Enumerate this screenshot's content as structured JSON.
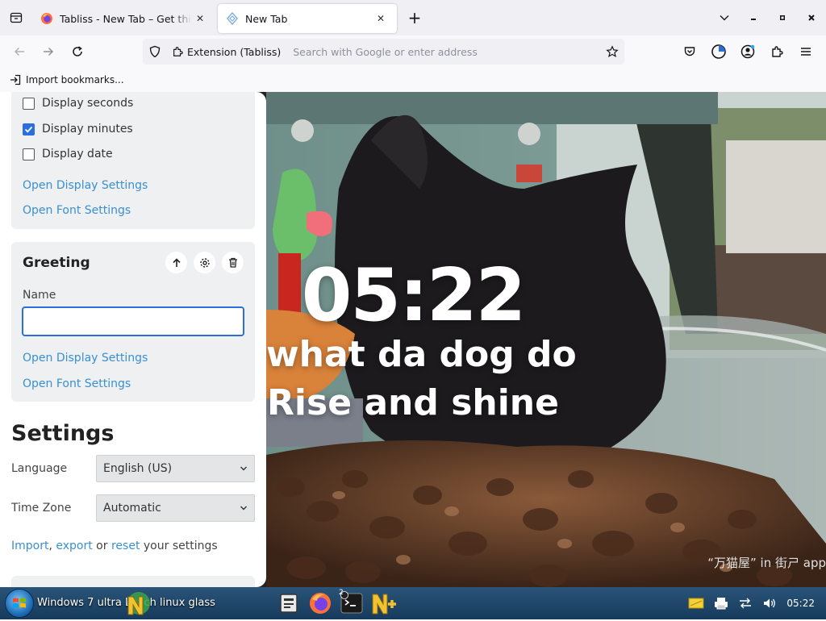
{
  "browser": {
    "tabs": [
      {
        "title": "Tabliss - New Tab – Get this Extension for Firefox",
        "active": false
      },
      {
        "title": "New Tab",
        "active": true
      }
    ],
    "urlbar": {
      "identity_label": "Extension (Tabliss)",
      "placeholder": "Search with Google or enter address"
    },
    "bookmarks_bar": {
      "import_label": "Import bookmarks..."
    }
  },
  "panel": {
    "time_widget": {
      "checkboxes": [
        {
          "label": "Display seconds",
          "checked": false
        },
        {
          "label": "Display minutes",
          "checked": true
        },
        {
          "label": "Display date",
          "checked": false
        }
      ],
      "links": [
        "Open Display Settings",
        "Open Font Settings"
      ]
    },
    "greeting_widget": {
      "title": "Greeting",
      "name_label": "Name",
      "name_value": "",
      "links": [
        "Open Display Settings",
        "Open Font Settings"
      ]
    },
    "settings": {
      "heading": "Settings",
      "language_label": "Language",
      "language_value": "English (US)",
      "timezone_label": "Time Zone",
      "timezone_value": "Automatic",
      "footer": {
        "import": "Import",
        "sep": ", ",
        "export": "export",
        "or": " or ",
        "reset": "reset",
        "tail": " your settings"
      }
    }
  },
  "dashboard": {
    "time": "05:22",
    "message": "what da dog do",
    "greeting": "Rise and shine",
    "photo_credit": "“万猫屋” in 街ㄕ app"
  },
  "taskbar": {
    "start_label": "Windows 7 ultra Lunch linux glass",
    "terminal_badge": "2",
    "clock": "05:22"
  },
  "colors": {
    "accent": "#2b6fde",
    "link": "#3a8fcf",
    "card_bg": "#eef0f2"
  }
}
